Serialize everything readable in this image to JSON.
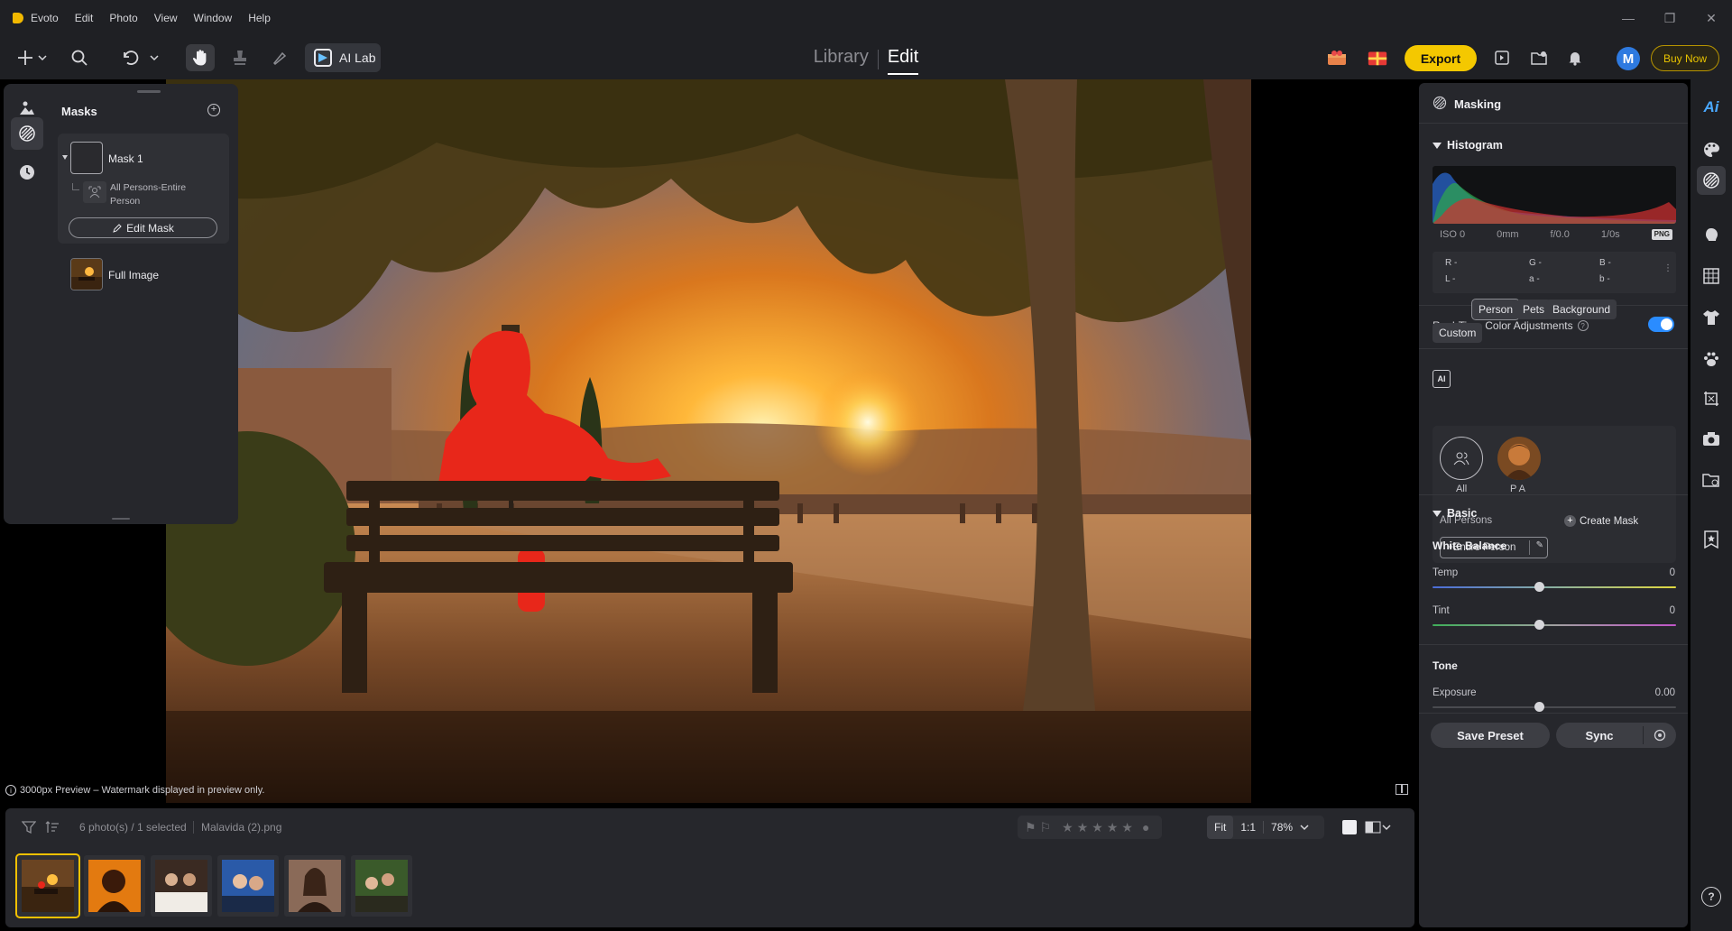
{
  "app": {
    "title": "Evoto",
    "menu": [
      "Edit",
      "Photo",
      "View",
      "Window",
      "Help"
    ]
  },
  "window_controls": {
    "minimize": "—",
    "restore": "❐",
    "close": "✕"
  },
  "toolbar": {
    "ai_lab_label": "AI Lab",
    "mode_tabs": {
      "library": "Library",
      "edit": "Edit"
    },
    "export_label": "Export",
    "avatar_initial": "M",
    "buy_now_label": "Buy Now"
  },
  "canvas": {
    "preview_note": "3000px Preview – Watermark displayed in preview only."
  },
  "masks_panel": {
    "title": "Masks",
    "mask1": {
      "name": "Mask 1",
      "submask": "All Persons-Entire Person",
      "edit_button": "Edit Mask"
    },
    "full_image": "Full Image"
  },
  "right_panel": {
    "title": "Masking",
    "histogram": {
      "title": "Histogram",
      "iso": "ISO 0",
      "focal": "0mm",
      "aperture": "f/0.0",
      "shutter": "1/0s",
      "format": "PNG",
      "r": "R -",
      "g": "G -",
      "b": "B -",
      "l": "L -",
      "a": "a -",
      "b2": "b -"
    },
    "realtime": {
      "label": "Real-Time Color Adjustments",
      "enabled": true
    },
    "subject_chips": [
      "Person",
      "Pets",
      "Background",
      "Custom"
    ],
    "active_chip": "Person",
    "persons": {
      "all_label": "All",
      "pa_label": "P A",
      "all_persons": "All Persons",
      "create_mask": "Create Mask",
      "entire_person": "+Entire Person"
    },
    "basic": {
      "title": "Basic",
      "white_balance": "White Balance",
      "temp": {
        "label": "Temp",
        "value": "0"
      },
      "tint": {
        "label": "Tint",
        "value": "0"
      },
      "tone": "Tone",
      "exposure": {
        "label": "Exposure",
        "value": "0.00"
      }
    },
    "save_preset": "Save Preset",
    "sync": "Sync"
  },
  "filmstrip": {
    "count": "6 photo(s) / 1 selected",
    "filename": "Malavida (2).png",
    "zoom": {
      "fit": "Fit",
      "one_to_one": "1:1",
      "percent": "78%"
    },
    "rating_stars": 5,
    "thumbnails": 6,
    "selected_index": 0
  },
  "colors": {
    "accent_yellow": "#f4c800",
    "toggle_blue": "#2a8cff",
    "mask_overlay_red": "#e8271a"
  }
}
